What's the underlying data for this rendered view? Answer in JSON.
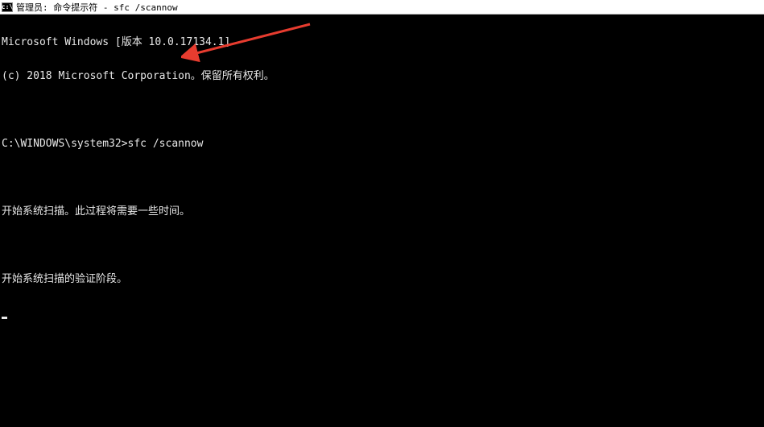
{
  "titlebar": {
    "icon_label": "C:\\",
    "text": "管理员: 命令提示符 - sfc  /scannow"
  },
  "terminal": {
    "lines": [
      "Microsoft Windows [版本 10.0.17134.1]",
      "(c) 2018 Microsoft Corporation。保留所有权利。",
      "",
      "C:\\WINDOWS\\system32>sfc /scannow",
      "",
      "开始系统扫描。此过程将需要一些时间。",
      "",
      "开始系统扫描的验证阶段。"
    ]
  },
  "annotation": {
    "arrow_color": "#e73c2f"
  }
}
